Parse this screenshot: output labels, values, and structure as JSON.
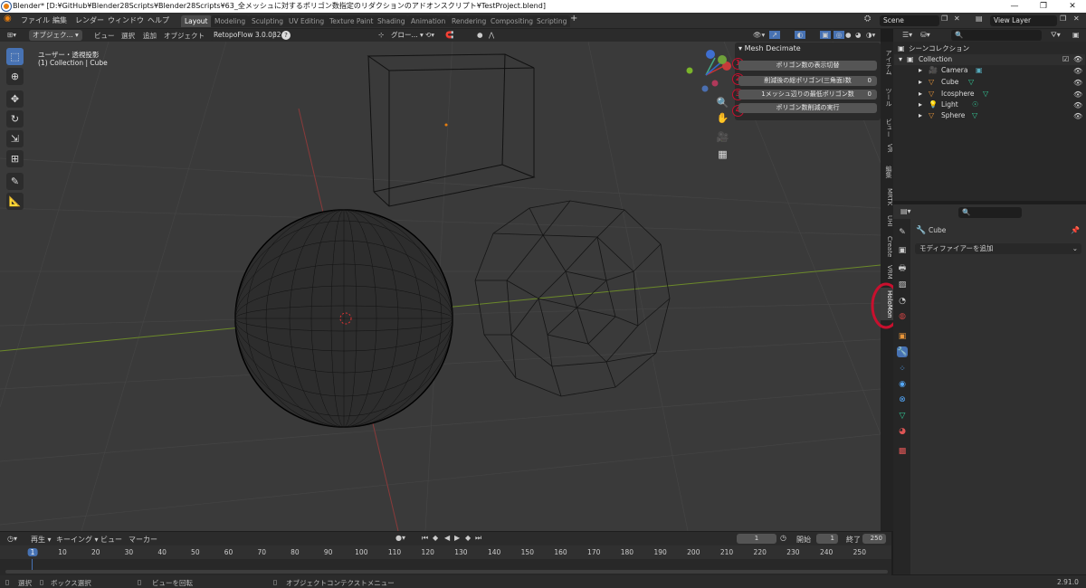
{
  "window": {
    "title": "Blender* [D:¥GitHub¥Blender28Scripts¥Blender28Scripts¥63_全メッシュに対するポリゴン数指定のリダクションのアドオンスクリプト¥TestProject.blend]",
    "controls": [
      "—",
      "❐",
      "✕"
    ]
  },
  "menubar": {
    "items": [
      "ファイル",
      "編集",
      "レンダー",
      "ウィンドウ",
      "ヘルプ"
    ],
    "workspaces": [
      "Layout",
      "Modeling",
      "Sculpting",
      "UV Editing",
      "Texture Paint",
      "Shading",
      "Animation",
      "Rendering",
      "Compositing",
      "Scripting"
    ],
    "active_workspace": "Layout",
    "scene": "Scene",
    "view_layer": "View Layer"
  },
  "viewport_header": {
    "mode": "オブジェク...",
    "menus": [
      "ビュー",
      "選択",
      "追加",
      "オブジェクト"
    ],
    "addon_dropdown": "RetopoFlow 3.0.0β2",
    "transform_orientation": "グロー..."
  },
  "viewport": {
    "view_name": "ユーザー・透視投影",
    "collection_info": "(1) Collection | Cube",
    "gizmo_axes": [
      "X",
      "Y",
      "Z"
    ]
  },
  "npanel": {
    "title": "Mesh Decimate",
    "rows": [
      {
        "marker": "1",
        "label": "ポリゴン数の表示切替",
        "value": ""
      },
      {
        "marker": "2",
        "label": "削減後の総ポリゴン(三角面)数",
        "value": "0"
      },
      {
        "marker": "3",
        "label": "1メッシュ辺りの最低ポリゴン数",
        "value": "0"
      },
      {
        "marker": "4",
        "label": "ポリゴン数削減の実行",
        "value": ""
      }
    ]
  },
  "side_tabs": [
    "アイテム",
    "ツール",
    "ビュー",
    "VR",
    "編集",
    "MRTK",
    "UHI",
    "Create",
    "VRM",
    "HoloMon"
  ],
  "outliner": {
    "root": "シーンコレクション",
    "collection": "Collection",
    "objects": [
      {
        "name": "Camera",
        "icon": "camera-icon",
        "color": "#e8953a"
      },
      {
        "name": "Cube",
        "icon": "mesh-icon",
        "color": "#e8953a"
      },
      {
        "name": "Icosphere",
        "icon": "mesh-icon",
        "color": "#e8953a"
      },
      {
        "name": "Light",
        "icon": "light-icon",
        "color": "#e8953a"
      },
      {
        "name": "Sphere",
        "icon": "mesh-icon",
        "color": "#e8953a"
      }
    ]
  },
  "properties": {
    "object_name": "Cube",
    "add_modifier": "モディファイアーを追加"
  },
  "timeline": {
    "menus": [
      "再生",
      "キーイング",
      "ビュー",
      "マーカー"
    ],
    "current_frame": "1",
    "start_label": "開始",
    "start": "1",
    "end_label": "終了",
    "end": "250",
    "ruler": [
      "1",
      "10",
      "20",
      "30",
      "40",
      "50",
      "60",
      "70",
      "80",
      "90",
      "100",
      "110",
      "120",
      "130",
      "140",
      "150",
      "160",
      "170",
      "180",
      "190",
      "200",
      "210",
      "220",
      "230",
      "240",
      "250"
    ]
  },
  "statusbar": {
    "select": "選択",
    "box_select": "ボックス選択",
    "rotate_view": "ビューを回転",
    "context_menu": "オブジェクトコンテクストメニュー",
    "version": "2.91.0"
  },
  "colors": {
    "accent": "#4772b3",
    "highlight_circle": "#c8102e",
    "x_axis": "#8a3a3a",
    "y_axis": "#6c8a2a"
  }
}
